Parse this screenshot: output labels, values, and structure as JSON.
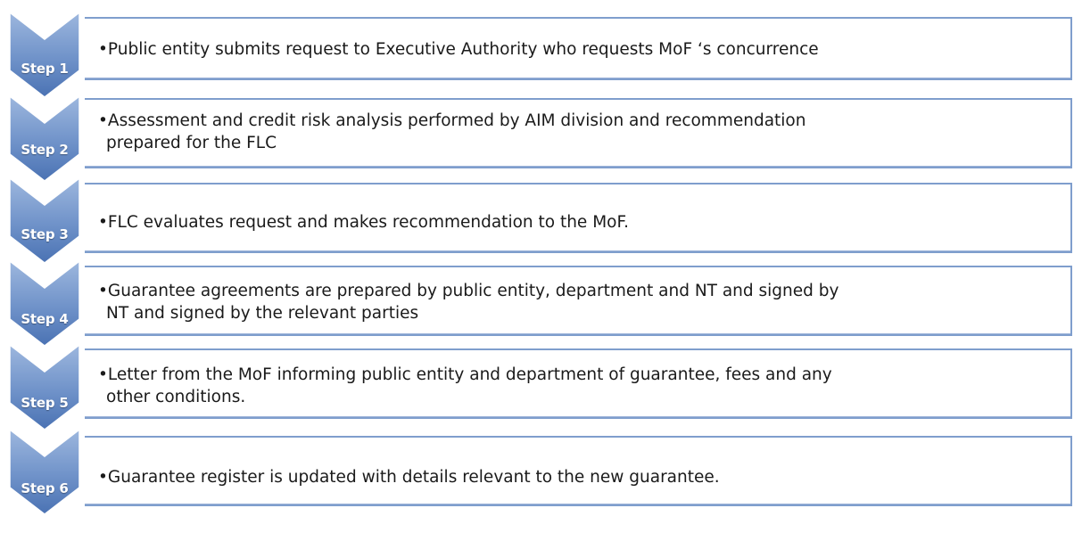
{
  "steps": [
    {
      "label": "Step 1",
      "lines": [
        "•Public entity submits request to Executive Authority who requests MoF ‘s concurrence"
      ]
    },
    {
      "label": "Step 2",
      "lines": [
        "•Assessment and credit risk analysis performed by AIM division and recommendation",
        "prepared for the FLC"
      ]
    },
    {
      "label": "Step 3",
      "lines": [
        "•FLC evaluates request and makes recommendation to the MoF."
      ]
    },
    {
      "label": "Step 4",
      "lines": [
        "•Guarantee agreements are prepared by public entity, department and NT and signed by",
        "NT and signed by the relevant parties"
      ]
    },
    {
      "label": "Step 5",
      "lines": [
        "•Letter from the MoF informing  public entity and department of guarantee, fees and any",
        "other conditions."
      ]
    },
    {
      "label": "Step 6",
      "lines": [
        "•Guarantee register is updated with details relevant to the new guarantee."
      ]
    }
  ],
  "colors": {
    "chevron_light": "#8aa9d6",
    "chevron_dark": "#4c74b4",
    "box_border": "#7f9ecd"
  }
}
